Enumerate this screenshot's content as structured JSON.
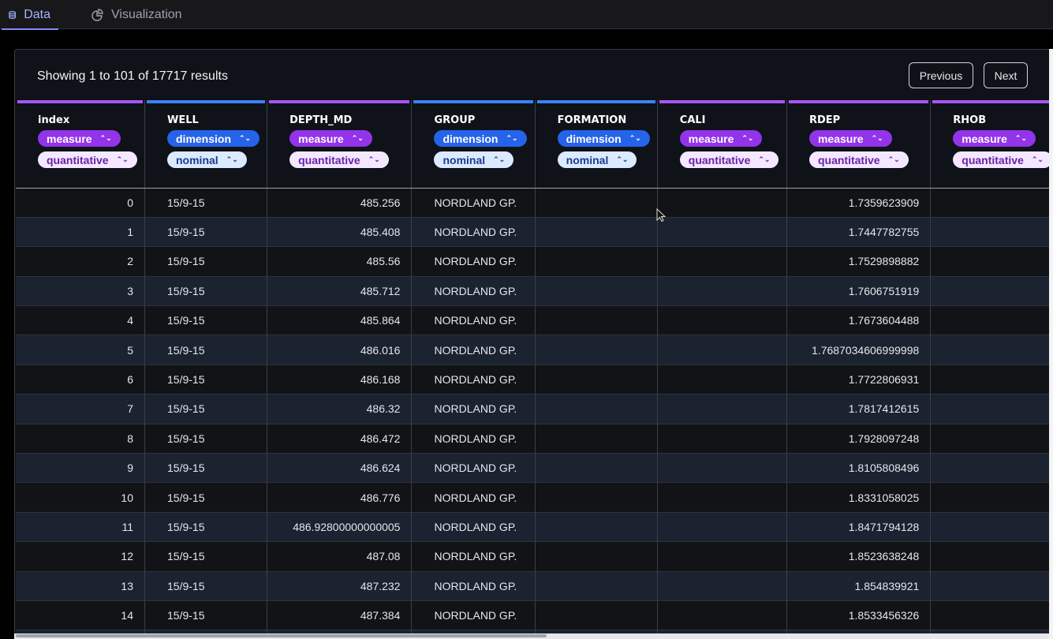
{
  "tabs": [
    {
      "label": "Data",
      "icon": "database-icon",
      "active": true
    },
    {
      "label": "Visualization",
      "icon": "pie-chart-icon",
      "active": false
    }
  ],
  "summary": "Showing 1 to 101 of 17717 results",
  "buttons": {
    "previous": "Previous",
    "next": "Next"
  },
  "colors": {
    "measure": "#a855f7",
    "dimension": "#3b82f6"
  },
  "columns": [
    {
      "name": "index",
      "role": "measure",
      "type": "quantitative",
      "width": 181,
      "align": "num"
    },
    {
      "name": "WELL",
      "role": "dimension",
      "type": "nominal",
      "width": 172,
      "align": "text"
    },
    {
      "name": "DEPTH_MD",
      "role": "measure",
      "type": "quantitative",
      "width": 191,
      "align": "num"
    },
    {
      "name": "GROUP",
      "role": "dimension",
      "type": "nominal",
      "width": 172,
      "align": "text"
    },
    {
      "name": "FORMATION",
      "role": "dimension",
      "type": "nominal",
      "width": 172,
      "align": "text"
    },
    {
      "name": "CALI",
      "role": "measure",
      "type": "quantitative",
      "width": 182,
      "align": "num"
    },
    {
      "name": "RDEP",
      "role": "measure",
      "type": "quantitative",
      "width": 188,
      "align": "num"
    },
    {
      "name": "RHOB",
      "role": "measure",
      "type": "quantitative",
      "width": 100,
      "align": "num"
    }
  ],
  "rows": [
    [
      "0",
      "15/9-15",
      "485.256",
      "NORDLAND GP.",
      "",
      "",
      "1.7359623909",
      ""
    ],
    [
      "1",
      "15/9-15",
      "485.408",
      "NORDLAND GP.",
      "",
      "",
      "1.7447782755",
      ""
    ],
    [
      "2",
      "15/9-15",
      "485.56",
      "NORDLAND GP.",
      "",
      "",
      "1.7529898882",
      ""
    ],
    [
      "3",
      "15/9-15",
      "485.712",
      "NORDLAND GP.",
      "",
      "",
      "1.7606751919",
      ""
    ],
    [
      "4",
      "15/9-15",
      "485.864",
      "NORDLAND GP.",
      "",
      "",
      "1.7673604488",
      ""
    ],
    [
      "5",
      "15/9-15",
      "486.016",
      "NORDLAND GP.",
      "",
      "",
      "1.7687034606999998",
      ""
    ],
    [
      "6",
      "15/9-15",
      "486.168",
      "NORDLAND GP.",
      "",
      "",
      "1.7722806931",
      ""
    ],
    [
      "7",
      "15/9-15",
      "486.32",
      "NORDLAND GP.",
      "",
      "",
      "1.7817412615",
      ""
    ],
    [
      "8",
      "15/9-15",
      "486.472",
      "NORDLAND GP.",
      "",
      "",
      "1.7928097248",
      ""
    ],
    [
      "9",
      "15/9-15",
      "486.624",
      "NORDLAND GP.",
      "",
      "",
      "1.8105808496",
      ""
    ],
    [
      "10",
      "15/9-15",
      "486.776",
      "NORDLAND GP.",
      "",
      "",
      "1.8331058025",
      ""
    ],
    [
      "11",
      "15/9-15",
      "486.92800000000005",
      "NORDLAND GP.",
      "",
      "",
      "1.8471794128",
      ""
    ],
    [
      "12",
      "15/9-15",
      "487.08",
      "NORDLAND GP.",
      "",
      "",
      "1.8523638248",
      ""
    ],
    [
      "13",
      "15/9-15",
      "487.232",
      "NORDLAND GP.",
      "",
      "",
      "1.854839921",
      ""
    ],
    [
      "14",
      "15/9-15",
      "487.384",
      "NORDLAND GP.",
      "",
      "",
      "1.8533456326",
      ""
    ],
    [
      "",
      "",
      "",
      "",
      "",
      "",
      "",
      ""
    ]
  ]
}
